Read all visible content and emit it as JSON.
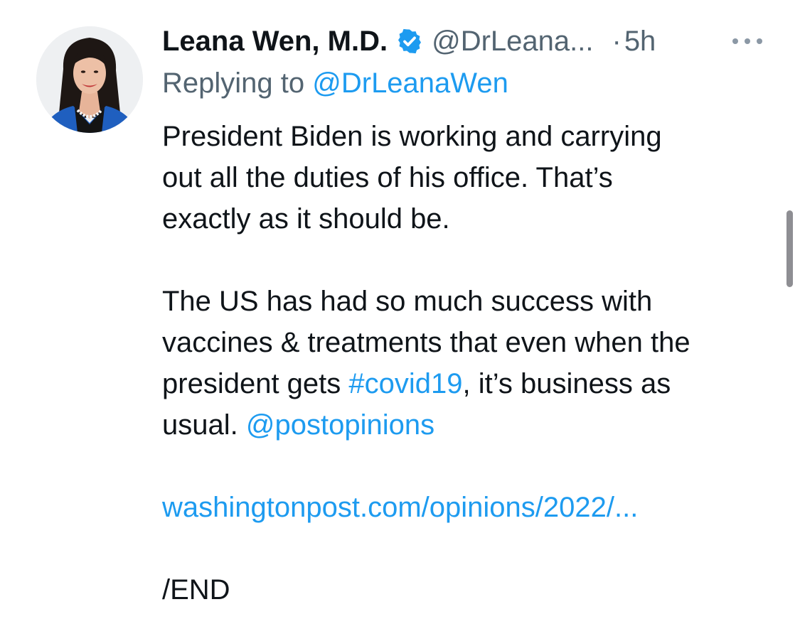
{
  "tweet": {
    "author_name": "Leana Wen, M.D.",
    "handle": "@DrLeana...",
    "separator": "·",
    "time": "5h",
    "reply_prefix": "Replying to",
    "reply_handle": "@DrLeanaWen",
    "paragraph1": {
      "line1": "President Biden is working and carrying",
      "line2": "out all the duties of his office. That’s",
      "line3": "exactly as it should be."
    },
    "paragraph2": {
      "line1": "The US has had so much success with",
      "line2": "vaccines & treatments that even when the",
      "line3_prefix": "president gets",
      "hashtag": "#covid19",
      "line3_suffix": ", it’s business as",
      "line4_prefix": "usual.",
      "mention": "@postopinions"
    },
    "url": "washingtonpost.com/opinions/2022/...",
    "end_text": "/END"
  },
  "icons": {
    "verified": "verified-badge-icon",
    "more": "more-options-icon"
  },
  "colors": {
    "link": "#1d9bf0",
    "secondary_text": "#536471",
    "primary_text": "#0f1419",
    "verified": "#1d9bf0"
  }
}
